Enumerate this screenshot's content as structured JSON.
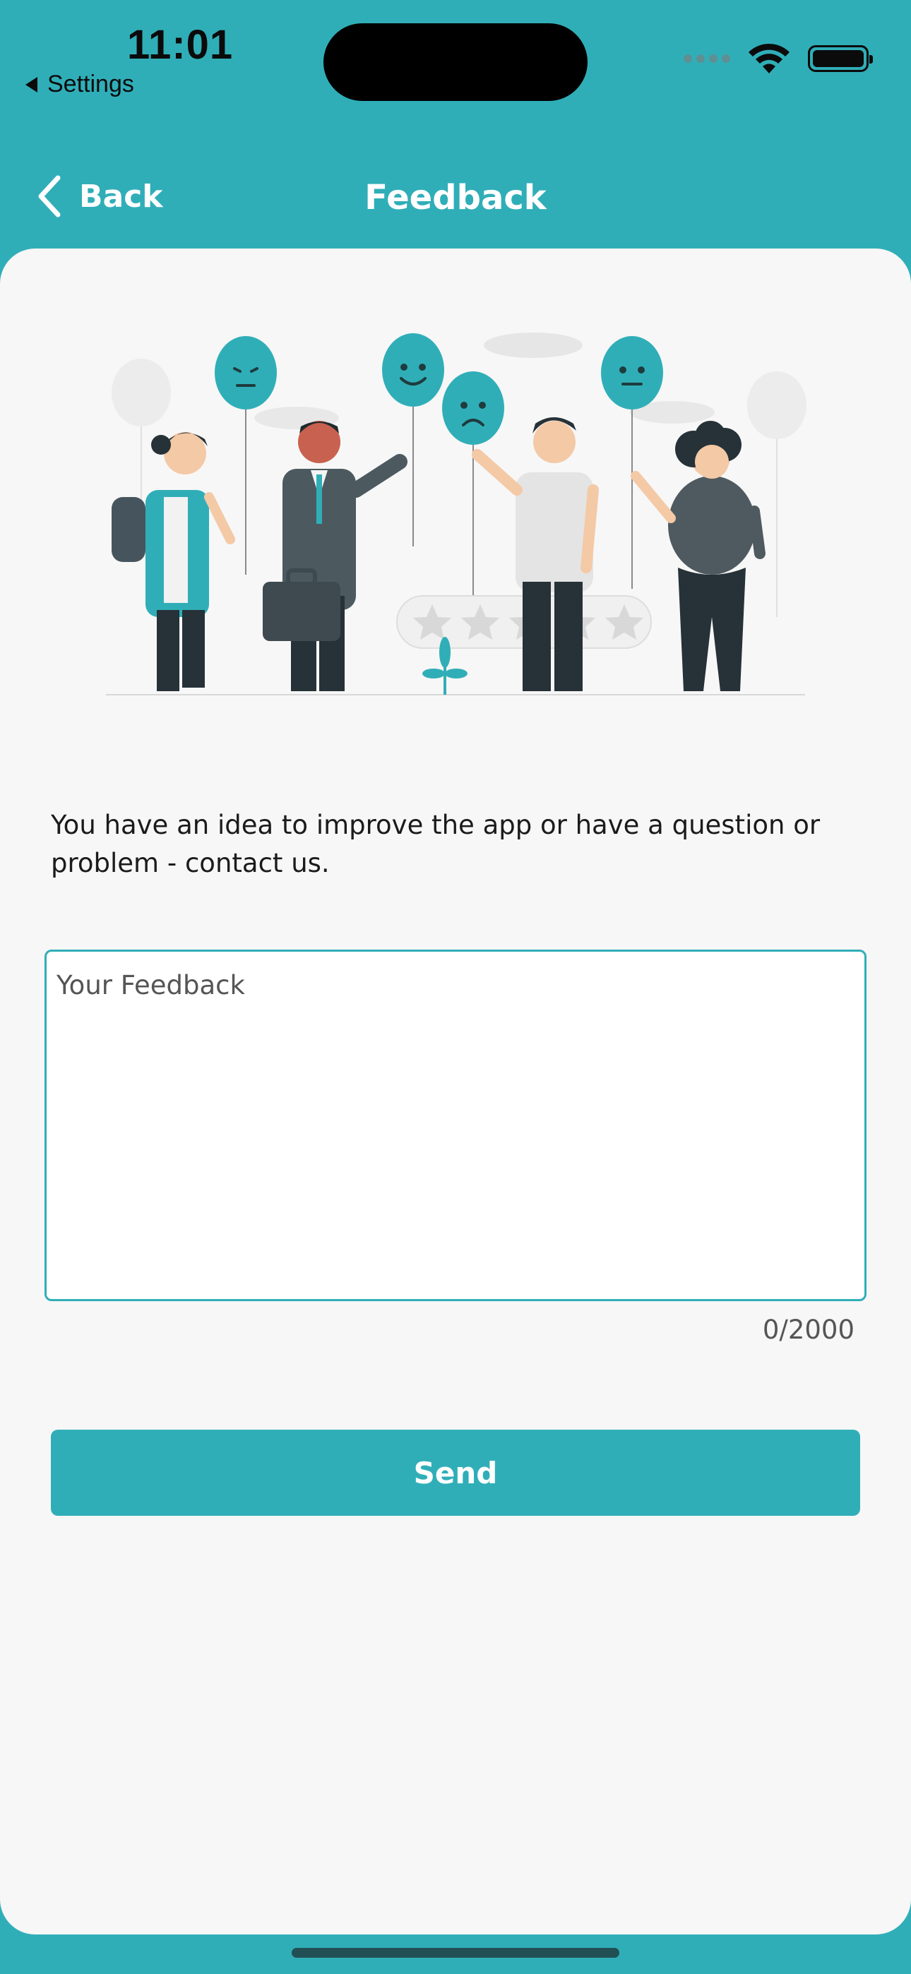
{
  "status_bar": {
    "time": "11:01",
    "back_app_label": "Settings"
  },
  "nav": {
    "back_label": "Back",
    "title": "Feedback"
  },
  "content": {
    "intro_text": "You have an idea to improve the app or have a question or problem - contact us.",
    "feedback_placeholder": "Your Feedback",
    "char_counter": "0/2000",
    "send_label": "Send"
  },
  "colors": {
    "primary": "#30aeb8",
    "background": "#f7f7f7",
    "text": "#1b1b1b"
  },
  "icons": [
    "chevron-left-icon",
    "wifi-icon",
    "battery-icon",
    "cellular-signal-icon"
  ]
}
